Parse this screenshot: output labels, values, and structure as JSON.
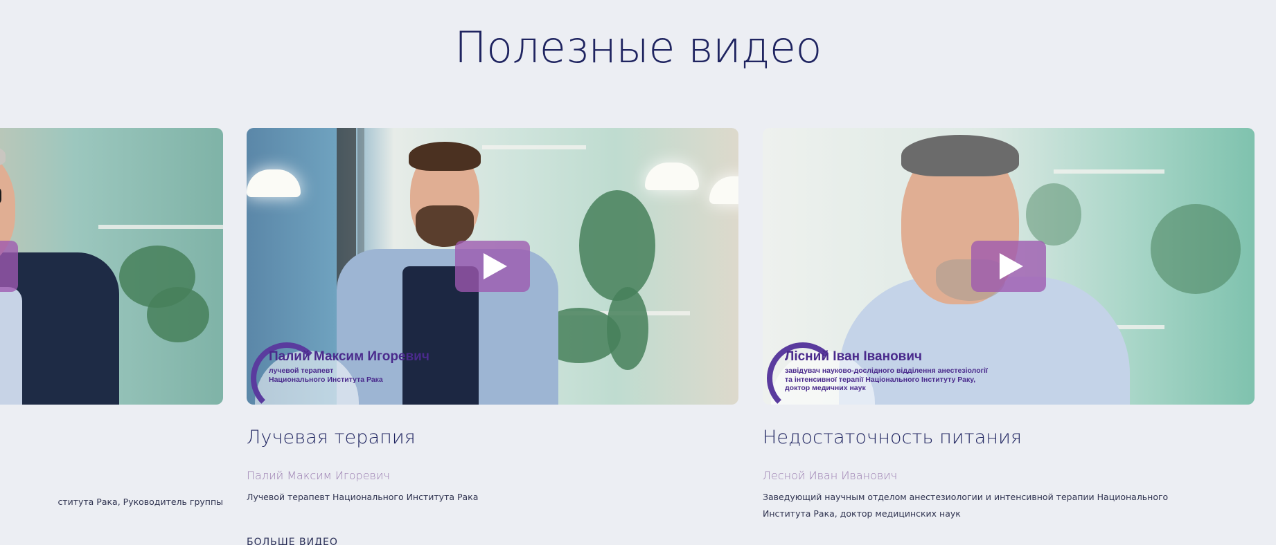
{
  "section": {
    "title": "Полезные видео"
  },
  "cards": [
    {
      "title": "",
      "author": "",
      "description": "ститута Рака, Руководитель группы",
      "play_icon": "play-icon",
      "overlay": {
        "name": "",
        "subtitle": ""
      }
    },
    {
      "title": "Лучевая терапия",
      "author": "Палий Максим Игоревич",
      "description": "Лучевой терапевт Национального Института Рака",
      "play_icon": "play-icon",
      "overlay": {
        "name": "Палий Максим Игоревич",
        "subtitle": "лучевой терапевт\nНационального Института Рака"
      }
    },
    {
      "title": "Недостаточность питания",
      "author": "Лесной Иван Иванович",
      "description": "Заведующий научным отделом анестезиологии и интенсивной терапии Национального Института Рака, доктор медицинских наук",
      "play_icon": "play-icon",
      "overlay": {
        "name": "Лісний Іван Іванович",
        "subtitle": "завідувач науково-дослідного відділення анестезіології\nта інтенсивної терапії Національного Інституту Раку,\nдоктор медичних наук"
      }
    }
  ],
  "more": {
    "label": "БОЛЬШЕ ВИДЕО"
  },
  "colors": {
    "background": "#eceef3",
    "heading": "#1f2460",
    "accent": "#9d58af",
    "author": "#9a7db0"
  }
}
